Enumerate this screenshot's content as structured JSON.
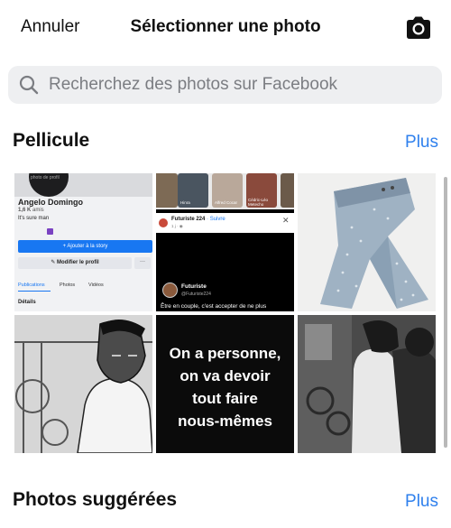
{
  "header": {
    "cancel_label": "Annuler",
    "title": "Sélectionner une photo",
    "camera_icon": "camera-icon"
  },
  "search": {
    "placeholder": "Recherchez des photos sur Facebook",
    "icon": "search-icon"
  },
  "camera_roll": {
    "title": "Pellicule",
    "more_label": "Plus",
    "photos": [
      {
        "kind": "profile-screenshot",
        "avatar_label": "photo de profil",
        "name": "Angelo Domingo",
        "friends_count": "1,6 K",
        "friends_label": "amis",
        "bio": "It's sure man",
        "story_button": "+ Ajouter à la story",
        "edit_button": "✎ Modifier le profil",
        "more_button": "···",
        "tabs": [
          "Publications",
          "Photos",
          "Vidéos"
        ],
        "details": "Détails"
      },
      {
        "kind": "post-screenshot",
        "stories": [
          "Hinra",
          "Alfred Cocar",
          "Cédric-Léo Metecho"
        ],
        "card_name": "Futuriste 224",
        "card_follow": " · Suivre",
        "card_meta": "1 j · ◉",
        "card_close": "✕",
        "name": "Futuriste",
        "handle": "@Futuriste224",
        "text": "Être en couple, c'est accepter de ne plus"
      },
      {
        "kind": "photo-jeans"
      },
      {
        "kind": "manga-gym-illustration"
      },
      {
        "kind": "quote-image",
        "lines": [
          "On a personne,",
          "on va devoir",
          "tout faire",
          "nous-mêmes"
        ]
      },
      {
        "kind": "photo-gym"
      }
    ]
  },
  "suggested": {
    "title": "Photos suggérées",
    "more_label": "Plus"
  },
  "colors": {
    "accent": "#2f80ed",
    "search_bg": "#eeeff1",
    "facebook_blue": "#1877f2"
  }
}
